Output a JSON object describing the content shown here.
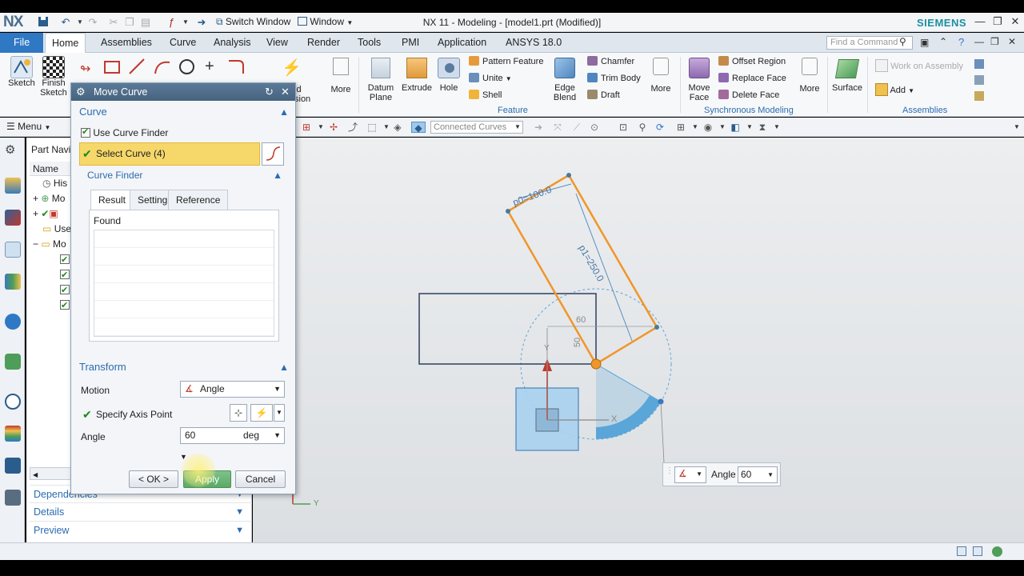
{
  "app": {
    "logo": "NX",
    "title": "NX 11 - Modeling - [model1.prt (Modified)]",
    "brand": "SIEMENS",
    "switch_window": "Switch Window",
    "window_menu": "Window",
    "find_command": "Find a Command"
  },
  "tabs": [
    "File",
    "Home",
    "Assemblies",
    "Curve",
    "Analysis",
    "View",
    "Render",
    "Tools",
    "PMI",
    "Application",
    "ANSYS 18.0"
  ],
  "ribbon": {
    "sketch": "Sketch",
    "finish_sketch_1": "Finish",
    "finish_sketch_2": "Sketch",
    "more_1": "More",
    "datum_plane_1": "Datum",
    "datum_plane_2": "Plane",
    "extrude": "Extrude",
    "hole": "Hole",
    "pattern_feature": "Pattern Feature",
    "unite": "Unite",
    "shell": "Shell",
    "edge_blend_1": "Edge",
    "edge_blend_2": "Blend",
    "chamfer": "Chamfer",
    "trim_body": "Trim Body",
    "draft": "Draft",
    "more_2": "More",
    "move_face_1": "Move",
    "move_face_2": "Face",
    "offset_region": "Offset Region",
    "replace_face": "Replace Face",
    "delete_face": "Delete Face",
    "more_3": "More",
    "surface": "Surface",
    "work_on_assembly": "Work on Assembly",
    "add": "Add",
    "group_feature": "Feature",
    "group_sync": "Synchronous Modeling",
    "group_assemblies": "Assemblies",
    "solid_label_partial": "id",
    "solid_label_partial2": "sion"
  },
  "toolbar2": {
    "menu": "Menu",
    "curve_filter": "Connected Curves"
  },
  "navigator": {
    "title": "Part Navig",
    "col_name": "Name",
    "rows": [
      "His",
      "Mo",
      "",
      "Use",
      "Mo"
    ],
    "sections": [
      "Dependencies",
      "Details",
      "Preview"
    ]
  },
  "dialog": {
    "title": "Move Curve",
    "curve_section": "Curve",
    "use_curve_finder": "Use Curve Finder",
    "select_curve": "Select Curve (4)",
    "curve_finder": "Curve Finder",
    "subtabs": [
      "Result",
      "Setting",
      "Reference"
    ],
    "found": "Found",
    "transform_section": "Transform",
    "motion_label": "Motion",
    "motion_value": "Angle",
    "axis_point_label": "Specify Axis Point",
    "angle_label": "Angle",
    "angle_value": "60",
    "angle_unit": "deg",
    "ok": "< OK >",
    "apply": "Apply",
    "cancel": "Cancel"
  },
  "graphics": {
    "dim_p0": "p0=100.0",
    "dim_p1": "p1=250.0",
    "dim_60": "60",
    "dim_50": "50",
    "axis_x": "X",
    "axis_y": "Y",
    "triad_y": "Y",
    "angle_popup_label": "Angle",
    "angle_popup_value": "60"
  },
  "colors": {
    "accent": "#2a6cb0",
    "selection": "#f6d76a",
    "sketch_orange": "#f0962a",
    "rect_outline": "#2e3f5e",
    "arc_blue": "#5aa6d8"
  }
}
